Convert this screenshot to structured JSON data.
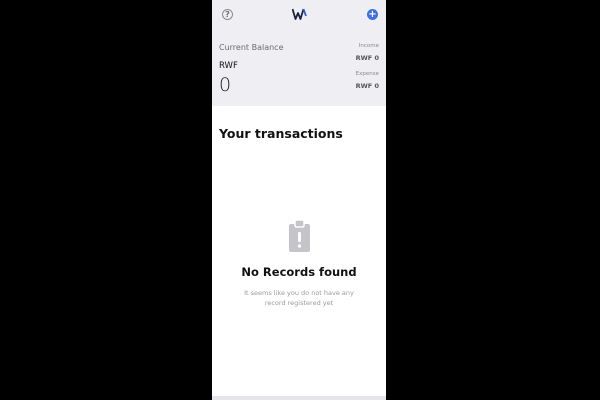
{
  "header": {
    "help_icon": "help-circle-icon",
    "help_glyph": "?",
    "logo_icon": "w-logo-icon",
    "add_icon": "plus-circle-icon",
    "add_glyph": "+"
  },
  "balance": {
    "label": "Current Balance",
    "currency": "RWF",
    "amount": "0"
  },
  "stats": {
    "income_label": "Income",
    "income_value": "RWF 0",
    "expense_label": "Expense",
    "expense_value": "RWF 0"
  },
  "transactions": {
    "title": "Your transactions"
  },
  "empty_state": {
    "icon": "clipboard-alert-icon",
    "title": "No Records found",
    "description": "It seems like you do not have any record registered yet"
  },
  "colors": {
    "accent": "#3f6fe0",
    "header_bg": "#efeff3"
  }
}
